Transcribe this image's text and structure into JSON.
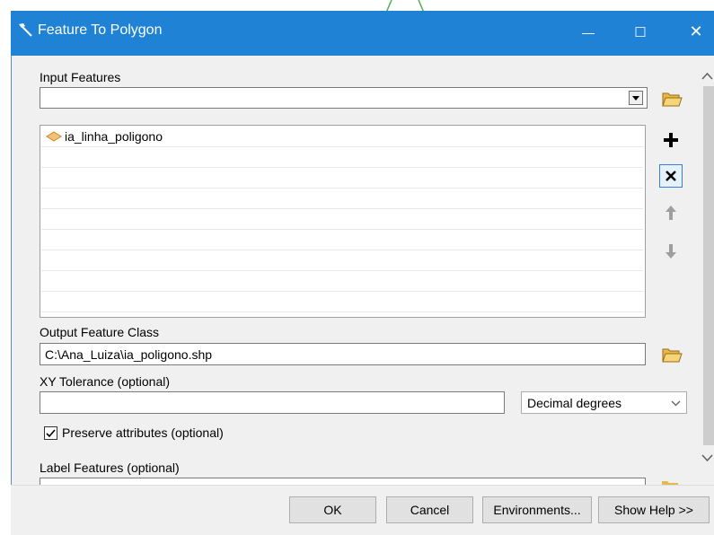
{
  "window": {
    "title": "Feature To Polygon"
  },
  "window_controls": {
    "minimize": "—",
    "maximize": "☐",
    "close": "✕"
  },
  "input_features": {
    "label": "Input Features",
    "value": "",
    "list_items": [
      "ia_linha_poligono"
    ]
  },
  "output": {
    "label": "Output Feature Class",
    "value": "C:\\Ana_Luiza\\ia_poligono.shp"
  },
  "xy_tolerance": {
    "label": "XY Tolerance (optional)",
    "value": "",
    "units": "Decimal degrees"
  },
  "preserve": {
    "label": "Preserve attributes (optional)",
    "checked": true
  },
  "label_features": {
    "label": "Label Features (optional)"
  },
  "buttons": {
    "ok": "OK",
    "cancel": "Cancel",
    "environments": "Environments...",
    "show_help": "Show Help >>"
  }
}
